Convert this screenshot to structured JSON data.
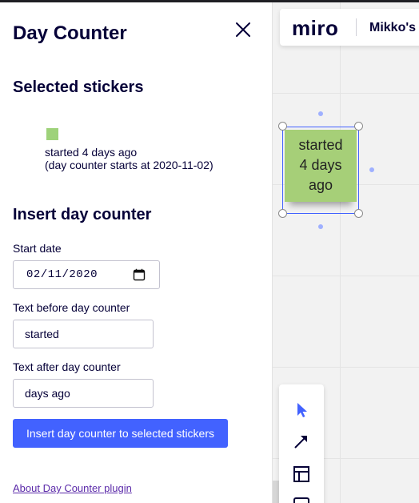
{
  "plugin": {
    "title": "Day Counter",
    "selected_section_title": "Selected stickers",
    "selected_sticker": {
      "color": "#9ed27a",
      "text": "started 4 days ago",
      "note": "(day counter starts at 2020-11-02)"
    },
    "insert_section_title": "Insert day counter",
    "start_date": {
      "label": "Start date",
      "value": "02/11/2020"
    },
    "text_before": {
      "label": "Text before day counter",
      "value": "started"
    },
    "text_after": {
      "label": "Text after day counter",
      "value": "days ago"
    },
    "insert_button": "Insert day counter to selected stickers",
    "about_link": "About Day Counter plugin"
  },
  "board": {
    "logo": "miro",
    "board_name": "Mikko's",
    "sticky": {
      "lines": [
        "started",
        "4 days",
        "ago"
      ],
      "color": "#a6cf78"
    },
    "accent_color": "#4262ff",
    "tools": [
      "select-icon",
      "arrow-icon",
      "template-icon",
      "frame-icon"
    ]
  }
}
